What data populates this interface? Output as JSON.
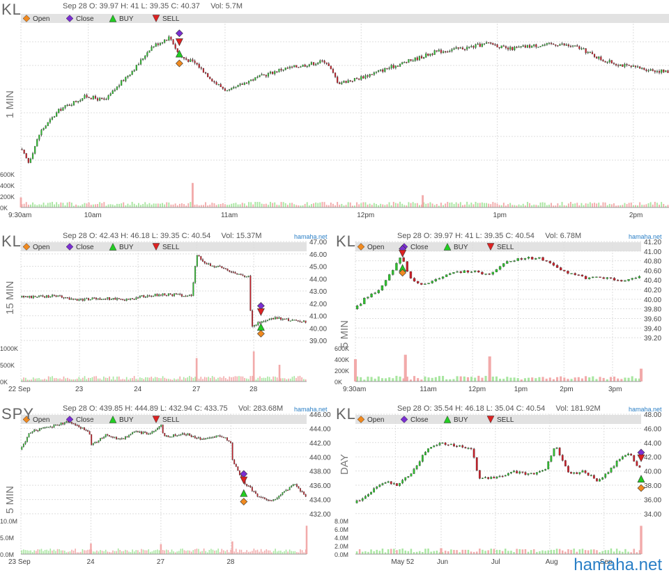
{
  "watermark": "hamaha.net",
  "legend": {
    "open": "Open",
    "close": "Close",
    "buy": "BUY",
    "sell": "SELL"
  },
  "colors": {
    "up": "#2fbf2f",
    "down": "#c8202a",
    "wick": "#222",
    "vol_up": "#a8e6a0",
    "vol_down": "#f2aaaa",
    "open_marker": "#f08a20",
    "close_marker": "#7a2fd0",
    "buy_marker": "#22cc22",
    "sell_marker": "#dd2222",
    "watermark": "#2a7fc6",
    "legend_bar": "#e2e2e2",
    "grid": "#dddddd"
  },
  "charts": [
    {
      "id": "kl1",
      "symbol": "KL",
      "timeframe": "1 MIN",
      "info": "Sep 28 O: 39.97 H: 41 L: 39.35 C: 40.37     Vol: 5.7M",
      "source": "",
      "price_ticks": [],
      "price_range": [
        39.35,
        41.0
      ],
      "vol_ticks": [
        "600K",
        "400K",
        "200K",
        "0K"
      ],
      "vol_max": 600000,
      "x_ticks": [
        {
          "t": 0,
          "l": "9:30am"
        },
        {
          "t": 0.104,
          "l": "10am"
        },
        {
          "t": 0.315,
          "l": "11am"
        },
        {
          "t": 0.525,
          "l": "12pm"
        },
        {
          "t": 0.735,
          "l": "1pm"
        },
        {
          "t": 0.945,
          "l": "2pm"
        }
      ],
      "n": 300,
      "path": [
        [
          0,
          39.55
        ],
        [
          0.012,
          39.4
        ],
        [
          0.03,
          39.75
        ],
        [
          0.06,
          40.0
        ],
        [
          0.1,
          40.15
        ],
        [
          0.13,
          40.1
        ],
        [
          0.16,
          40.35
        ],
        [
          0.18,
          40.5
        ],
        [
          0.2,
          40.7
        ],
        [
          0.23,
          40.82
        ],
        [
          0.245,
          40.6
        ],
        [
          0.27,
          40.52
        ],
        [
          0.3,
          40.3
        ],
        [
          0.32,
          40.2
        ],
        [
          0.35,
          40.32
        ],
        [
          0.4,
          40.45
        ],
        [
          0.45,
          40.52
        ],
        [
          0.47,
          40.55
        ],
        [
          0.49,
          40.3
        ],
        [
          0.52,
          40.35
        ],
        [
          0.56,
          40.45
        ],
        [
          0.6,
          40.55
        ],
        [
          0.64,
          40.65
        ],
        [
          0.69,
          40.7
        ],
        [
          0.725,
          40.75
        ],
        [
          0.75,
          40.68
        ],
        [
          0.79,
          40.72
        ],
        [
          0.83,
          40.74
        ],
        [
          0.86,
          40.7
        ],
        [
          0.9,
          40.55
        ],
        [
          0.94,
          40.48
        ],
        [
          0.97,
          40.45
        ],
        [
          1,
          40.42
        ]
      ],
      "vol_spikes": [
        {
          "t": 0.265,
          "v": 440000
        },
        {
          "t": 0.62,
          "v": 220000
        },
        {
          "t": 0,
          "v": 180000
        }
      ],
      "markers": {
        "t": 0.2445,
        "open": 40.52,
        "close": 40.86,
        "buy": 40.63,
        "sell": 40.76
      }
    },
    {
      "id": "kl15",
      "symbol": "KL",
      "timeframe": "15 MIN",
      "info": "Sep 28 O: 42.43 H: 46.18 L: 39.35 C: 40.54     Vol: 15.37M",
      "source": "hamaha.net",
      "price_ticks": [
        "47.00",
        "46.00",
        "45.00",
        "44.00",
        "43.00",
        "42.00",
        "41.00",
        "40.00",
        "39.00"
      ],
      "price_range": [
        38.5,
        47.0
      ],
      "vol_ticks": [
        "1000K",
        "500K",
        "0K"
      ],
      "vol_max": 1000000,
      "x_ticks": [
        {
          "t": 0,
          "l": "22 Sep"
        },
        {
          "t": 0.205,
          "l": "23"
        },
        {
          "t": 0.41,
          "l": "24"
        },
        {
          "t": 0.615,
          "l": "27"
        },
        {
          "t": 0.815,
          "l": "28"
        }
      ],
      "n": 150,
      "path": [
        [
          0,
          42.5
        ],
        [
          0.12,
          42.6
        ],
        [
          0.15,
          42.45
        ],
        [
          0.2,
          42.3
        ],
        [
          0.3,
          42.4
        ],
        [
          0.38,
          42.3
        ],
        [
          0.42,
          42.55
        ],
        [
          0.5,
          42.75
        ],
        [
          0.6,
          42.6
        ],
        [
          0.605,
          44.2
        ],
        [
          0.615,
          45.9
        ],
        [
          0.65,
          45.2
        ],
        [
          0.7,
          44.9
        ],
        [
          0.8,
          44.1
        ],
        [
          0.805,
          40.2
        ],
        [
          0.83,
          40.4
        ],
        [
          0.87,
          40.7
        ],
        [
          0.9,
          40.8
        ],
        [
          0.95,
          40.6
        ],
        [
          1,
          40.5
        ]
      ],
      "vol_spikes": [
        {
          "t": 0.615,
          "v": 700000
        },
        {
          "t": 0.815,
          "v": 900000
        },
        {
          "t": 0.905,
          "v": 500000
        }
      ],
      "markers": {
        "t": 0.84,
        "open": 39.55,
        "close": 41.8,
        "buy": 40.1,
        "sell": 41.3
      }
    },
    {
      "id": "kl5",
      "symbol": "KL",
      "timeframe": "5 MIN",
      "info": "Sep 28 O: 39.97 H: 41 L: 39.35 C: 40.54     Vol: 6.78M",
      "source": "hamaha.net",
      "price_ticks": [
        "41.20",
        "41.00",
        "40.80",
        "40.60",
        "40.40",
        "40.20",
        "40.00",
        "39.80",
        "39.60",
        "39.40",
        "39.20"
      ],
      "price_range": [
        39.1,
        41.2
      ],
      "vol_ticks": [
        "600K",
        "400K",
        "200K",
        "0K"
      ],
      "vol_max": 600000,
      "x_ticks": [
        {
          "t": 0,
          "l": "9:30am"
        },
        {
          "t": 0.24,
          "l": "11am"
        },
        {
          "t": 0.41,
          "l": "12pm"
        },
        {
          "t": 0.57,
          "l": "1pm"
        },
        {
          "t": 0.73,
          "l": "2pm"
        },
        {
          "t": 0.9,
          "l": "3pm"
        }
      ],
      "n": 80,
      "path": [
        [
          0,
          39.8
        ],
        [
          0.03,
          40.0
        ],
        [
          0.08,
          40.2
        ],
        [
          0.12,
          40.5
        ],
        [
          0.16,
          40.9
        ],
        [
          0.19,
          40.45
        ],
        [
          0.23,
          40.3
        ],
        [
          0.3,
          40.45
        ],
        [
          0.35,
          40.55
        ],
        [
          0.42,
          40.6
        ],
        [
          0.46,
          40.5
        ],
        [
          0.52,
          40.75
        ],
        [
          0.57,
          40.85
        ],
        [
          0.65,
          40.85
        ],
        [
          0.72,
          40.6
        ],
        [
          0.8,
          40.45
        ],
        [
          0.88,
          40.45
        ],
        [
          0.93,
          40.35
        ],
        [
          1,
          40.5
        ]
      ],
      "vol_spikes": [
        {
          "t": 0.0,
          "v": 400000
        },
        {
          "t": 0.175,
          "v": 480000
        },
        {
          "t": 0.47,
          "v": 450000
        },
        {
          "t": 1,
          "v": 230000
        }
      ],
      "markers": {
        "t": 0.165,
        "open": 40.55,
        "close": 41.05,
        "buy": 40.65,
        "sell": 40.95
      }
    },
    {
      "id": "spy5",
      "symbol": "SPY",
      "timeframe": "5 MIN",
      "info": "Sep 28 O: 439.85 H: 444.89 L: 432.94 C: 433.75     Vol: 283.68M",
      "source": "hamaha.net",
      "price_ticks": [
        "446.00",
        "444.00",
        "442.00",
        "440.00",
        "438.00",
        "436.00",
        "434.00",
        "432.00"
      ],
      "price_range": [
        432.0,
        446.0
      ],
      "vol_ticks": [
        "10.0M",
        "5.0M",
        "0.0M"
      ],
      "vol_max": 10000000,
      "x_ticks": [
        {
          "t": 0,
          "l": "23 Sep"
        },
        {
          "t": 0.245,
          "l": "24"
        },
        {
          "t": 0.49,
          "l": "27"
        },
        {
          "t": 0.735,
          "l": "28"
        }
      ],
      "n": 160,
      "path": [
        [
          0,
          441
        ],
        [
          0.03,
          443.5
        ],
        [
          0.1,
          444.2
        ],
        [
          0.17,
          445.0
        ],
        [
          0.24,
          443.5
        ],
        [
          0.245,
          441.5
        ],
        [
          0.3,
          443.2
        ],
        [
          0.35,
          442.4
        ],
        [
          0.4,
          443.5
        ],
        [
          0.45,
          443.2
        ],
        [
          0.49,
          444.5
        ],
        [
          0.5,
          442.8
        ],
        [
          0.58,
          443.2
        ],
        [
          0.63,
          442.5
        ],
        [
          0.7,
          443.0
        ],
        [
          0.735,
          442.0
        ],
        [
          0.74,
          439.5
        ],
        [
          0.78,
          436.5
        ],
        [
          0.83,
          434.5
        ],
        [
          0.88,
          433.8
        ],
        [
          0.92,
          435.0
        ],
        [
          0.96,
          436.2
        ],
        [
          1,
          434.2
        ]
      ],
      "vol_spikes": [
        {
          "t": 0.245,
          "v": 3200000
        },
        {
          "t": 0.49,
          "v": 3000000
        },
        {
          "t": 0.74,
          "v": 3800000
        },
        {
          "t": 1,
          "v": 8500000
        }
      ],
      "markers": {
        "t": 0.78,
        "open": 433.7,
        "close": 437.6,
        "buy": 434.9,
        "sell": 436.7
      }
    },
    {
      "id": "klday",
      "symbol": "KL",
      "timeframe": "DAY",
      "info": "Sep 28 O: 35.54 H: 46.18 L: 35.04 C: 40.54     Vol: 181.92M",
      "source": "hamaha.net",
      "price_ticks": [
        "48.00",
        "46.00",
        "44.00",
        "42.00",
        "40.00",
        "38.00",
        "36.00",
        "34.00"
      ],
      "price_range": [
        33.0,
        48.0
      ],
      "vol_ticks": [
        "8.0M",
        "6.0M",
        "4.0M",
        "2.0M",
        "0.0M"
      ],
      "vol_max": 8500000,
      "x_ticks": [
        {
          "t": 0.14,
          "l": "May 52"
        },
        {
          "t": 0.3,
          "l": "Jun"
        },
        {
          "t": 0.49,
          "l": "Jul"
        },
        {
          "t": 0.68,
          "l": "Aug"
        },
        {
          "t": 0.87,
          "l": "Sep"
        }
      ],
      "n": 100,
      "path": [
        [
          0,
          35.5
        ],
        [
          0.05,
          37.0
        ],
        [
          0.1,
          38.5
        ],
        [
          0.15,
          38.0
        ],
        [
          0.2,
          40.0
        ],
        [
          0.25,
          43.0
        ],
        [
          0.3,
          44.0
        ],
        [
          0.36,
          43.5
        ],
        [
          0.41,
          43.0
        ],
        [
          0.43,
          39.0
        ],
        [
          0.5,
          39.0
        ],
        [
          0.55,
          40.0
        ],
        [
          0.6,
          39.5
        ],
        [
          0.66,
          40.0
        ],
        [
          0.7,
          43.5
        ],
        [
          0.75,
          39.5
        ],
        [
          0.8,
          40.0
        ],
        [
          0.85,
          38.5
        ],
        [
          0.9,
          40.5
        ],
        [
          0.93,
          42.0
        ],
        [
          0.96,
          42.5
        ],
        [
          0.98,
          41.0
        ],
        [
          1,
          40.54
        ]
      ],
      "vol_spikes": [
        {
          "t": 1,
          "v": 7200000
        },
        {
          "t": 0.3,
          "v": 1500000
        }
      ],
      "markers": {
        "t": 1,
        "open": 37.6,
        "close": 42.6,
        "buy": 38.9,
        "sell": 41.8
      }
    }
  ]
}
